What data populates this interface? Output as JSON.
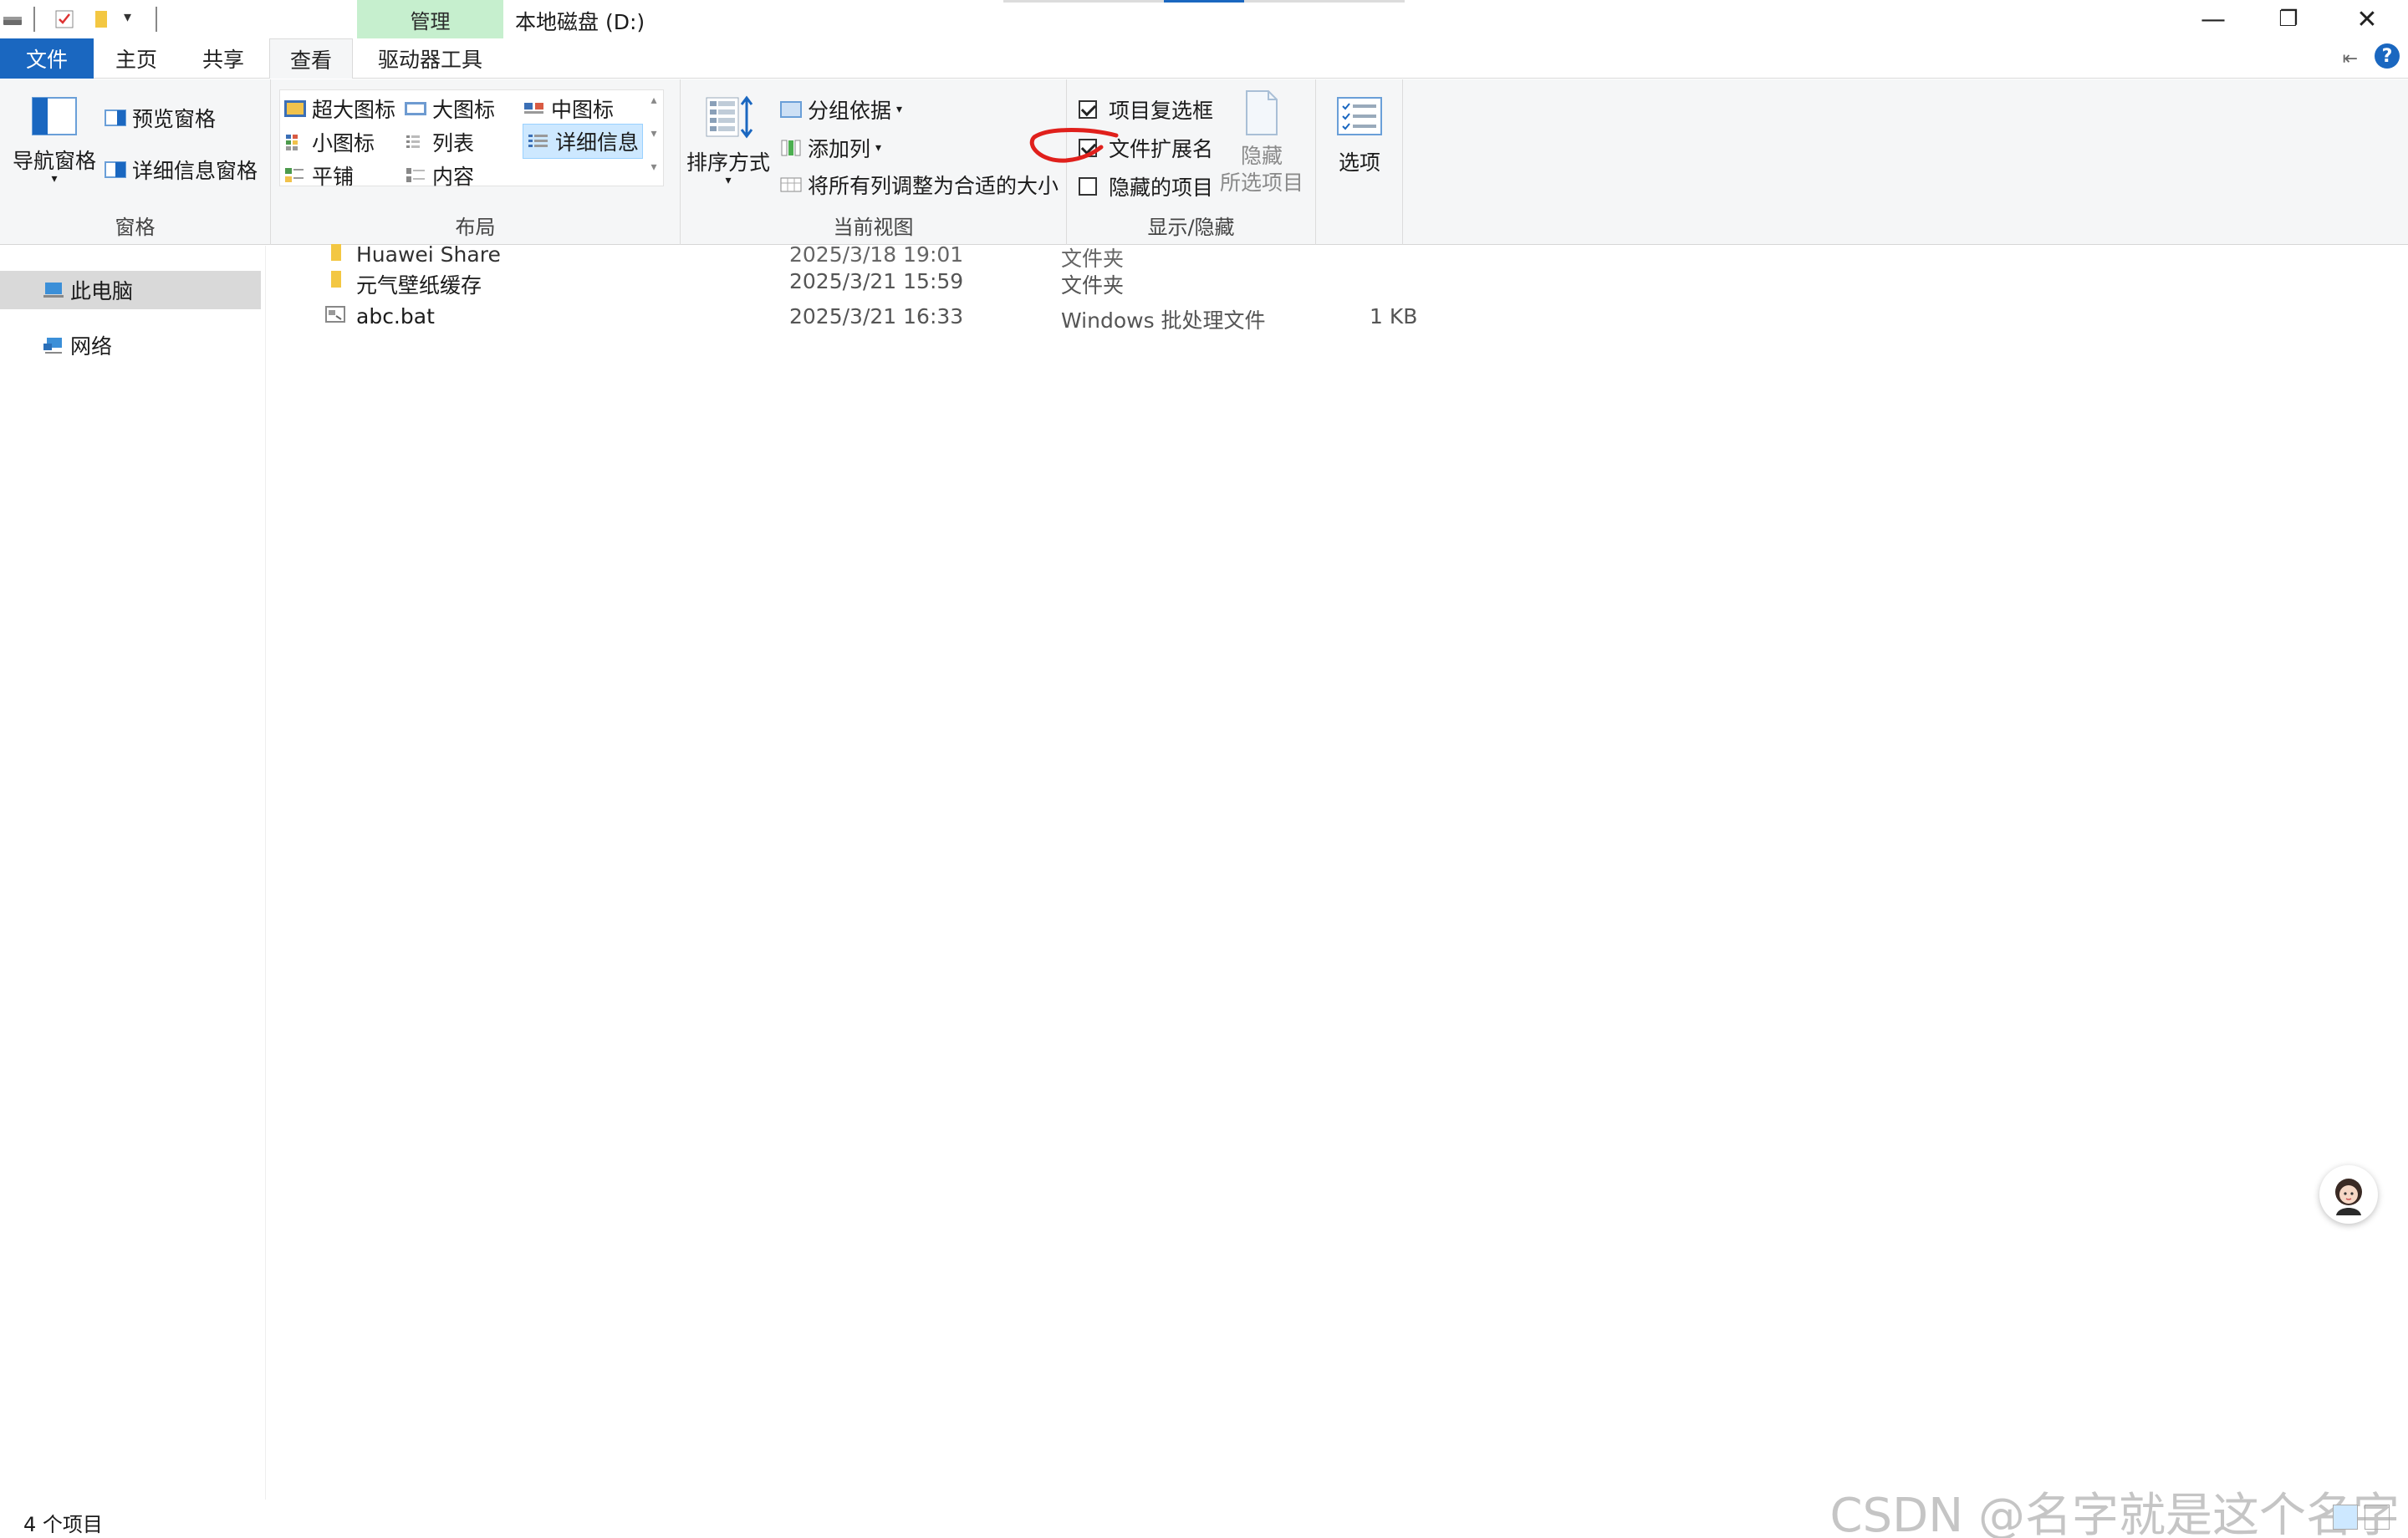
{
  "titlebar": {
    "context_tab": "管理",
    "window_title": "本地磁盘 (D:)",
    "minimize": "—",
    "restore": "❐",
    "close": "✕"
  },
  "tabs": {
    "file": "文件",
    "home": "主页",
    "share": "共享",
    "view": "查看",
    "drive_tools": "驱动器工具"
  },
  "ribbon": {
    "panes": {
      "label": "窗格",
      "nav_pane": "导航窗格",
      "preview_pane": "预览窗格",
      "details_pane": "详细信息窗格"
    },
    "layout": {
      "label": "布局",
      "extra_large": "超大图标",
      "large": "大图标",
      "medium": "中图标",
      "small": "小图标",
      "list": "列表",
      "details": "详细信息",
      "tiles": "平铺",
      "content": "内容"
    },
    "current_view": {
      "label": "当前视图",
      "sort_by": "排序方式",
      "group_by": "分组依据",
      "add_columns": "添加列",
      "size_all_columns": "将所有列调整为合适的大小"
    },
    "show_hide": {
      "label": "显示/隐藏",
      "item_checkboxes": "项目复选框",
      "item_checkboxes_checked": true,
      "file_extensions": "文件扩展名",
      "file_extensions_checked": true,
      "hidden_items": "隐藏的项目",
      "hidden_items_checked": false,
      "hide_selected_1": "隐藏",
      "hide_selected_2": "所选项目"
    },
    "options": "选项"
  },
  "nav": {
    "this_pc": "此电脑",
    "network": "网络"
  },
  "files": [
    {
      "name": "Huawei Share",
      "date": "2025/3/18 19:01",
      "type": "文件夹",
      "size": "",
      "icon": "folder-icon"
    },
    {
      "name": "元气壁纸缓存",
      "date": "2025/3/21 15:59",
      "type": "文件夹",
      "size": "",
      "icon": "folder-icon"
    },
    {
      "name": "abc.bat",
      "date": "2025/3/21 16:33",
      "type": "Windows 批处理文件",
      "size": "1 KB",
      "icon": "batch-file-icon"
    }
  ],
  "status": {
    "count": "4 个项目"
  },
  "watermark": "CSDN @名字就是这个名字",
  "colors": {
    "accent": "#1a67c0",
    "context_tab": "#c6efce",
    "selection": "#cde8ff",
    "annotation": "#e0201c"
  }
}
